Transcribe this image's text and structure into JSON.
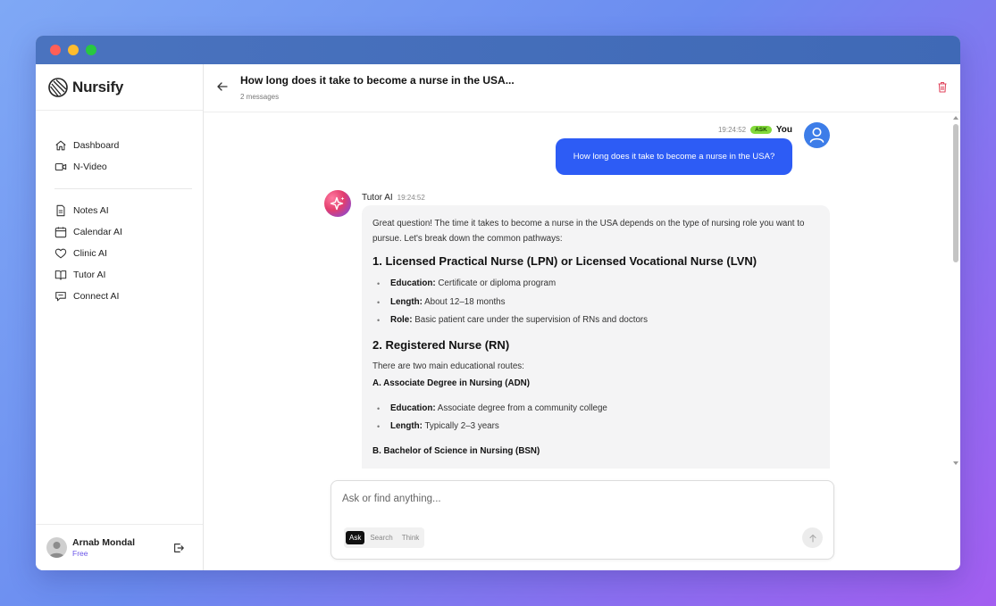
{
  "app": {
    "name": "Nursify"
  },
  "sidebar": {
    "items_top": [
      {
        "label": "Dashboard",
        "icon": "home-icon"
      },
      {
        "label": "N-Video",
        "icon": "video-icon"
      }
    ],
    "items_tools": [
      {
        "label": "Notes AI",
        "icon": "document-icon"
      },
      {
        "label": "Calendar AI",
        "icon": "calendar-icon"
      },
      {
        "label": "Clinic AI",
        "icon": "heart-icon"
      },
      {
        "label": "Tutor AI",
        "icon": "book-icon"
      },
      {
        "label": "Connect AI",
        "icon": "chat-icon"
      }
    ],
    "user": {
      "name": "Arnab Mondal",
      "plan": "Free"
    }
  },
  "header": {
    "title": "How long does it take to become a nurse in the USA...",
    "subtitle": "2 messages"
  },
  "messages": {
    "user": {
      "time": "19:24:52",
      "badge": "ASK",
      "author": "You",
      "text": "How long does it take to become a nurse in the USA?"
    },
    "ai": {
      "author": "Tutor AI",
      "time": "19:24:52",
      "intro": "Great question! The time it takes to become a nurse in the USA depends on the type of nursing role you want to pursue. Let's break down the common pathways:",
      "section1_title": "1. Licensed Practical Nurse (LPN) or Licensed Vocational Nurse (LVN)",
      "section1_items": [
        {
          "label": "Education:",
          "text": " Certificate or diploma program"
        },
        {
          "label": "Length:",
          "text": " About 12–18 months"
        },
        {
          "label": "Role:",
          "text": " Basic patient care under the supervision of RNs and doctors"
        }
      ],
      "section2_title": "2. Registered Nurse (RN)",
      "section2_intro": "There are two main educational routes:",
      "section2a_title": "A. Associate Degree in Nursing (ADN)",
      "section2a_items": [
        {
          "label": "Education:",
          "text": " Associate degree from a community college"
        },
        {
          "label": "Length:",
          "text": " Typically 2–3 years"
        }
      ],
      "section2b_title": "B. Bachelor of Science in Nursing (BSN)"
    }
  },
  "composer": {
    "placeholder": "Ask or find anything...",
    "modes": [
      "Ask",
      "Search",
      "Think"
    ],
    "active_mode": "Ask"
  },
  "colors": {
    "accent_blue": "#2d5cf5",
    "badge_green": "#83d93b",
    "plan_purple": "#6a55e8",
    "trash_red": "#e0455d"
  }
}
